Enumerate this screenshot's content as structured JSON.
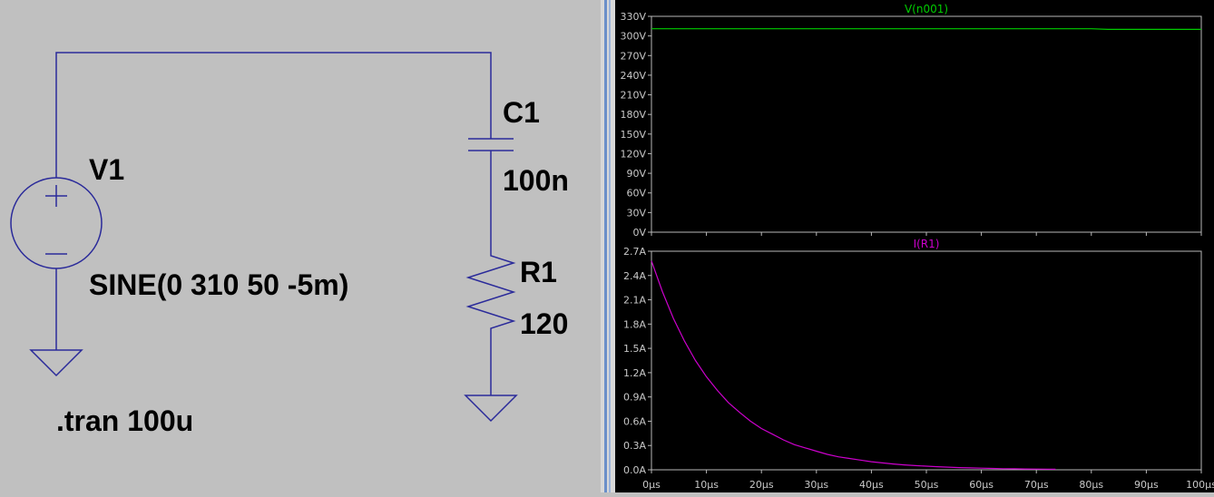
{
  "schematic": {
    "components": {
      "v1": {
        "name": "V1",
        "value": "SINE(0 310 50 -5m)"
      },
      "c1": {
        "name": "C1",
        "value": "100n"
      },
      "r1": {
        "name": "R1",
        "value": "120"
      }
    },
    "directive": ".tran 100u",
    "wire_color": "#2a2a9a"
  },
  "chart_data": [
    {
      "type": "line",
      "title": "V(n001)",
      "color": "#00cc00",
      "x_ticks": [],
      "y_ticks": [
        "330V",
        "300V",
        "270V",
        "240V",
        "210V",
        "180V",
        "150V",
        "120V",
        "90V",
        "60V",
        "30V",
        "0V"
      ],
      "xlim": [
        0,
        100
      ],
      "ylim": [
        0,
        330
      ],
      "x": [
        0,
        10,
        20,
        30,
        40,
        50,
        60,
        70,
        80,
        83,
        90,
        100
      ],
      "y": [
        311,
        311,
        311,
        311,
        311,
        311,
        311,
        311,
        311,
        310,
        310,
        310
      ],
      "grid": false
    },
    {
      "type": "line",
      "title": "I(R1)",
      "color": "#cc00cc",
      "x_ticks": [
        "0µs",
        "10µs",
        "20µs",
        "30µs",
        "40µs",
        "50µs",
        "60µs",
        "70µs",
        "80µs",
        "90µs",
        "100µs"
      ],
      "y_ticks": [
        "2.7A",
        "2.4A",
        "2.1A",
        "1.8A",
        "1.5A",
        "1.2A",
        "0.9A",
        "0.6A",
        "0.3A",
        "0.0A"
      ],
      "xlim": [
        0,
        100
      ],
      "ylim": [
        0,
        2.7
      ],
      "x": [
        0,
        2,
        4,
        6,
        8,
        10,
        12,
        14,
        16,
        18,
        20,
        22,
        24,
        26,
        28,
        30,
        32,
        34,
        36,
        38,
        40,
        42,
        44,
        46,
        48,
        50,
        52,
        54,
        56,
        58,
        60,
        62,
        64,
        66,
        68,
        70,
        72,
        73.5
      ],
      "y": [
        2.58,
        2.2,
        1.87,
        1.59,
        1.35,
        1.15,
        0.98,
        0.83,
        0.71,
        0.6,
        0.51,
        0.44,
        0.37,
        0.31,
        0.27,
        0.23,
        0.19,
        0.16,
        0.14,
        0.12,
        0.1,
        0.085,
        0.072,
        0.061,
        0.052,
        0.045,
        0.038,
        0.032,
        0.027,
        0.023,
        0.02,
        0.017,
        0.014,
        0.012,
        0.01,
        0.009,
        0.008,
        0.007
      ],
      "xlabel": "",
      "ylabel": "",
      "grid": false
    }
  ]
}
